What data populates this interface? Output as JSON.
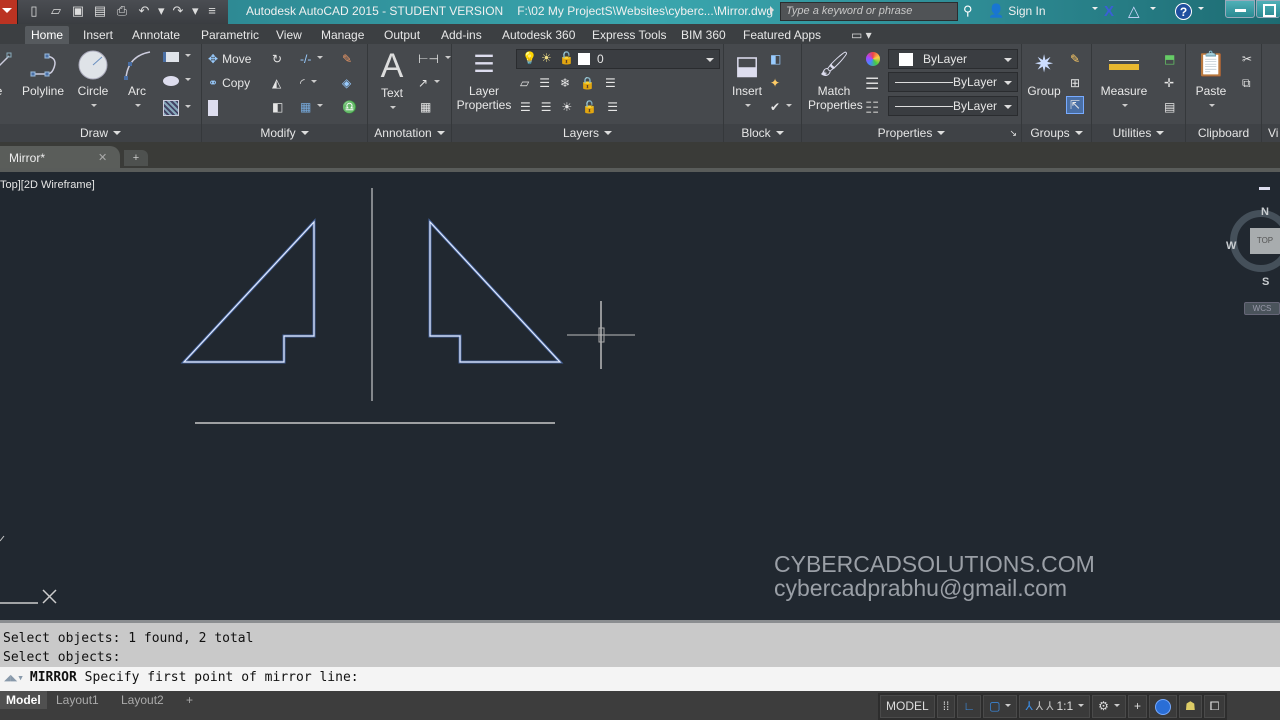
{
  "window": {
    "app_title": "Autodesk AutoCAD 2015 - STUDENT VERSION",
    "file_path": "F:\\02 My ProjectS\\Websites\\cyberc...\\Mirror.dwg",
    "search_placeholder": "Type a keyword or phrase",
    "sign_in": "Sign In"
  },
  "quick_access": [
    "new-icon",
    "open-icon",
    "save-icon",
    "saveas-icon",
    "plot-icon",
    "undo-icon",
    "redo-icon",
    "customize-icon"
  ],
  "ribbon_tabs": [
    {
      "label": "Home",
      "active": true
    },
    {
      "label": "Insert"
    },
    {
      "label": "Annotate"
    },
    {
      "label": "Parametric"
    },
    {
      "label": "View"
    },
    {
      "label": "Manage"
    },
    {
      "label": "Output"
    },
    {
      "label": "Add-ins"
    },
    {
      "label": "Autodesk 360"
    },
    {
      "label": "Express Tools"
    },
    {
      "label": "BIM 360"
    },
    {
      "label": "Featured Apps"
    }
  ],
  "ribbon": {
    "draw": {
      "label": "Draw",
      "line": "Line",
      "polyline": "Polyline",
      "circle": "Circle",
      "arc": "Arc"
    },
    "modify": {
      "label": "Modify",
      "move": "Move",
      "copy": "Copy"
    },
    "annotation": {
      "label": "Annotation",
      "text": "Text"
    },
    "layers": {
      "label": "Layers",
      "layer_properties_1": "Layer",
      "layer_properties_2": "Properties",
      "current_layer": "0"
    },
    "block": {
      "label": "Block",
      "insert": "Insert"
    },
    "properties": {
      "label": "Properties",
      "match_1": "Match",
      "match_2": "Properties",
      "color": "ByLayer",
      "linetype": "ByLayer",
      "lineweight": "ByLayer"
    },
    "groups": {
      "label": "Groups",
      "group": "Group"
    },
    "utilities": {
      "label": "Utilities",
      "measure": "Measure"
    },
    "clipboard": {
      "label": "Clipboard",
      "paste": "Paste"
    },
    "view_partial": "Vi"
  },
  "file_tab": {
    "name": "Mirror*"
  },
  "viewport": {
    "label": "Top][2D Wireframe]",
    "viewcube": {
      "top": "TOP",
      "n": "N",
      "s": "S",
      "w": "W",
      "wcs": "WCS"
    }
  },
  "watermark": {
    "line1": "CYBERCADSOLUTIONS.COM",
    "line2": "cybercadprabhu@gmail.com"
  },
  "command": {
    "history": [
      "Select objects: 1 found, 2 total",
      "Select objects:"
    ],
    "command_name": "MIRROR",
    "prompt": "Specify first point of mirror line:"
  },
  "layout_tabs": [
    {
      "label": "Model",
      "active": true
    },
    {
      "label": "Layout1"
    },
    {
      "label": "Layout2"
    }
  ],
  "status": {
    "model": "MODEL",
    "scale": "1:1"
  }
}
